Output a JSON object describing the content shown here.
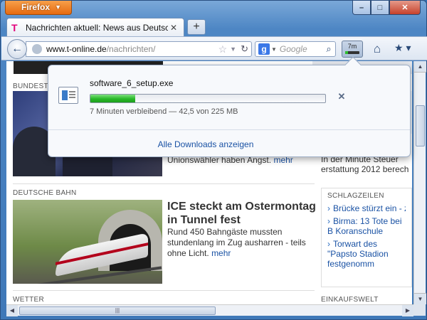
{
  "browser": {
    "menu_label": "Firefox",
    "tab_title": "Nachrichten aktuell: News aus Deutschla",
    "url_domain": "www.t-online.de",
    "url_path": "/nachrichten/",
    "search_placeholder": "Google",
    "download_badge": "7m",
    "download_progress": 0.19
  },
  "download_panel": {
    "filename": "software_6_setup.exe",
    "status": "7 Minuten verbleibend — 42,5 von 225 MB",
    "show_all": "Alle Downloads anzeigen",
    "progress": 0.19
  },
  "page": {
    "section1": "BUNDEST",
    "teaser1_text": "Unionswähler haben Angst.",
    "teaser1_more": "mehr",
    "section2": "DEUTSCHE BAHN",
    "headline2": "ICE steckt am Ostermontag in Tunnel fest",
    "text2": "Rund 450 Bahngäste mussten stundenlang im Zug ausharren - teils ohne Licht.",
    "text2_more": "mehr",
    "section3": "WETTER",
    "right_ad_1": "mart",
    "right_ad_2": "euer",
    "right_headline": "euer",
    "right_text": "In der Minute Steuer erstattung 2012 berech",
    "schlagzeilen_label": "SCHLAGZEILEN",
    "schlagzeilen": [
      "Brücke stürzt ein - zw",
      "Birma: 13 Tote bei B Koranschule",
      "Torwart des \"Papsto Stadion festgenomm"
    ],
    "einkaufswelt": "EINKAUFSWELT"
  }
}
